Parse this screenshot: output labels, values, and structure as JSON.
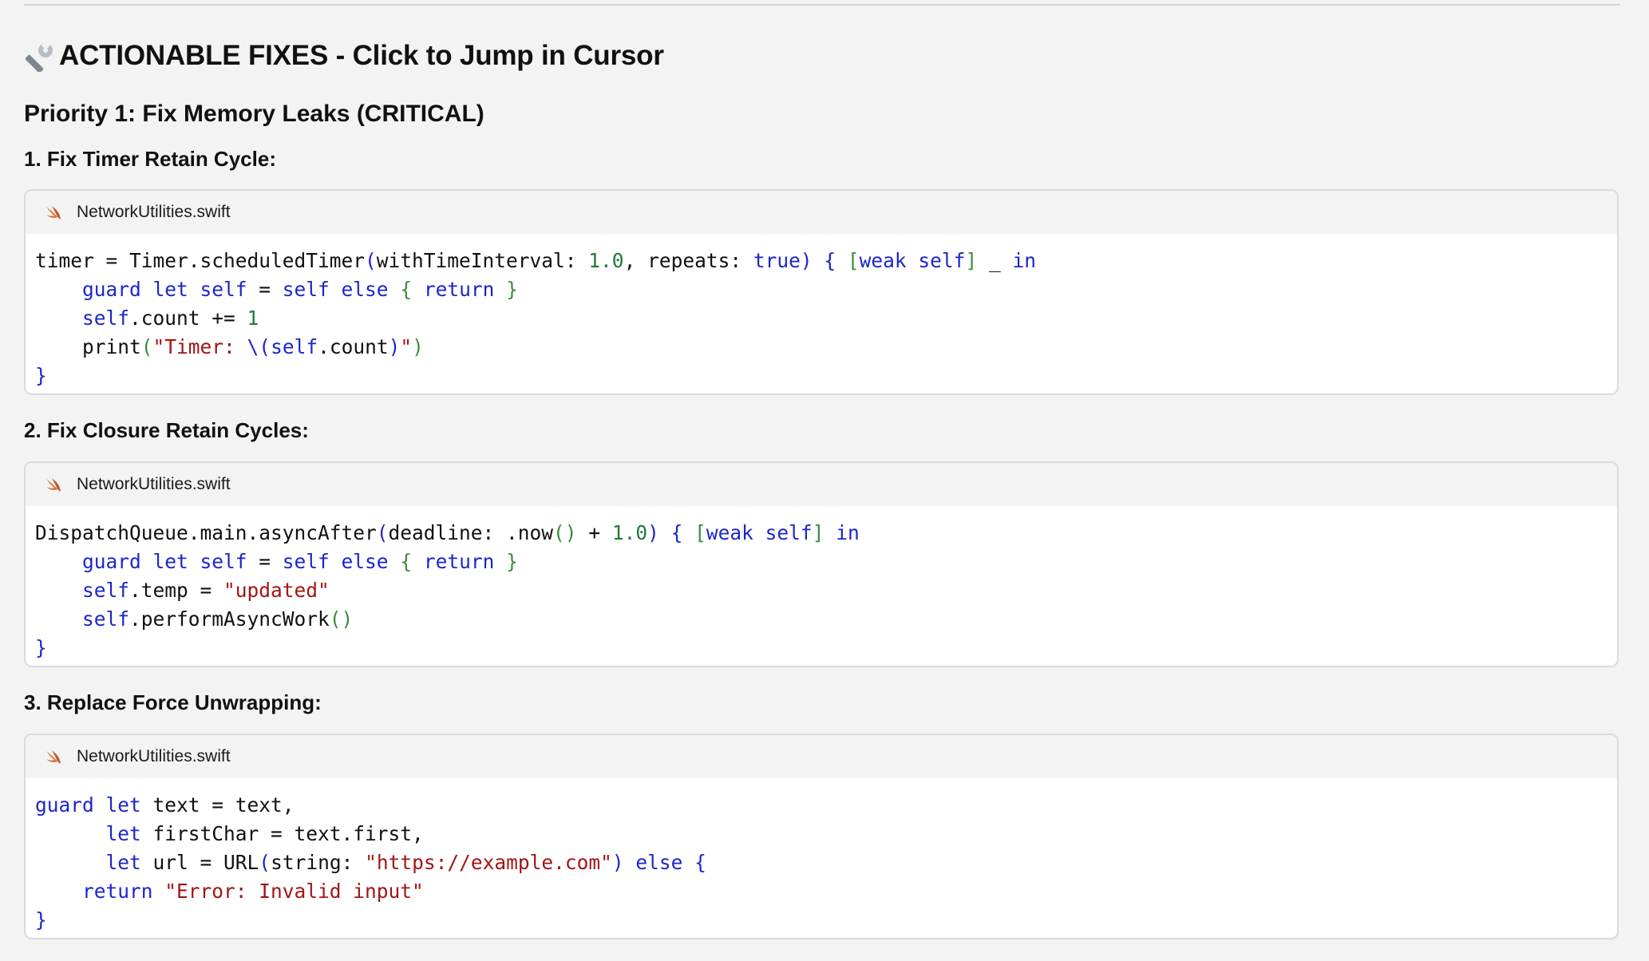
{
  "title": "ACTIONABLE FIXES - Click to Jump in Cursor",
  "priority_heading": "Priority 1: Fix Memory Leaks (CRITICAL)",
  "fixes": [
    {
      "heading": "1. Fix Timer Retain Cycle:",
      "filename": "NetworkUtilities.swift",
      "code": [
        "timer = Timer.scheduledTimer(withTimeInterval: 1.0, repeats: true) { [weak self] _ in",
        "    guard let self = self else { return }",
        "    self.count += 1",
        "    print(\"Timer: \\(self.count)\")",
        "}"
      ]
    },
    {
      "heading": "2. Fix Closure Retain Cycles:",
      "filename": "NetworkUtilities.swift",
      "code": [
        "DispatchQueue.main.asyncAfter(deadline: .now() + 1.0) { [weak self] in",
        "    guard let self = self else { return }",
        "    self.temp = \"updated\"",
        "    self.performAsyncWork()",
        "}"
      ]
    },
    {
      "heading": "3. Replace Force Unwrapping:",
      "filename": "NetworkUtilities.swift",
      "code": [
        "guard let text = text,",
        "      let firstChar = text.first,",
        "      let url = URL(string: \"https://example.com\") else {",
        "    return \"Error: Invalid input\"",
        "}"
      ]
    }
  ],
  "colors": {
    "keyword": "#1d26c9",
    "number": "#1f7a3a",
    "string": "#a31515",
    "paren": "#3b8c3b",
    "swift_logo": "#e0703a",
    "background": "#f3f3f3"
  },
  "icons": {
    "title_icon": "wrench-icon",
    "file_icon": "swift-icon"
  }
}
